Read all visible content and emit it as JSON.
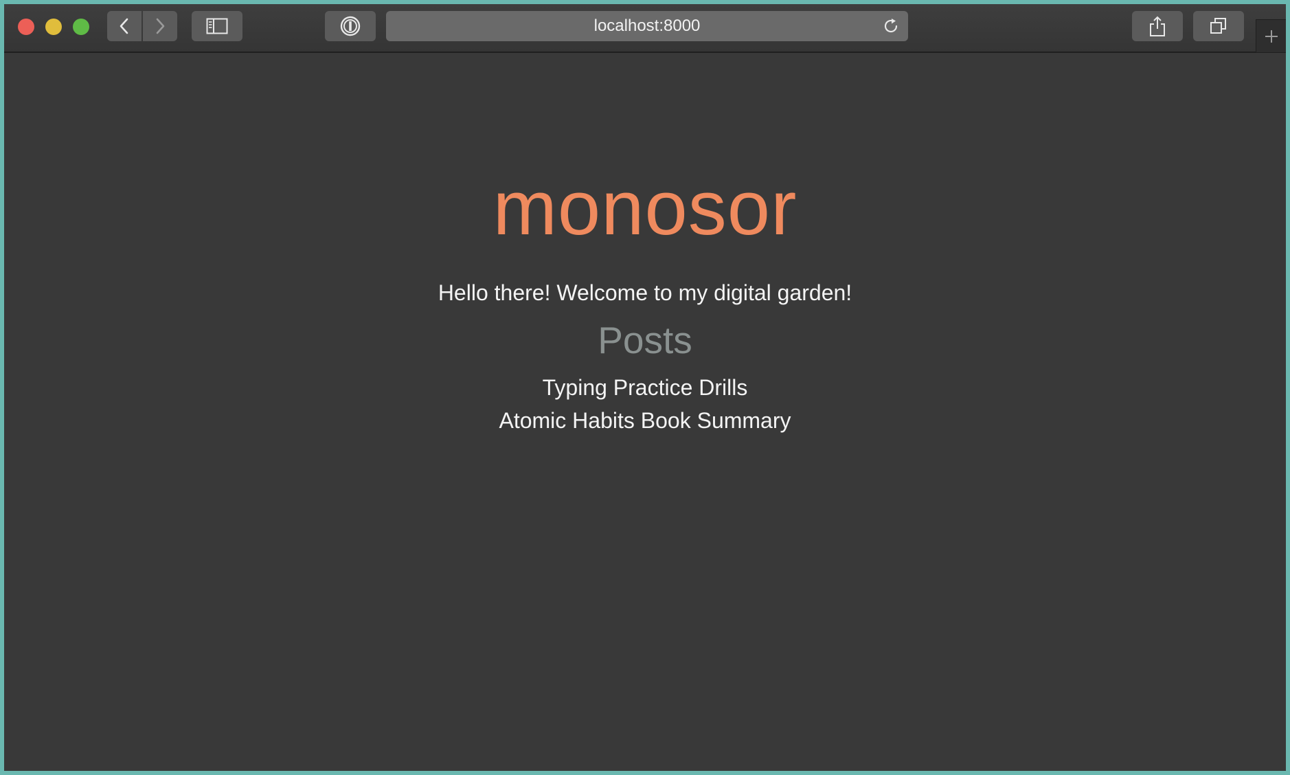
{
  "browser": {
    "url": "localhost:8000",
    "icons": {
      "back": "chevron-left-icon",
      "forward": "chevron-right-icon",
      "sidebar": "sidebar-icon",
      "password": "password-manager-icon",
      "reload": "reload-icon",
      "share": "share-icon",
      "tabs": "tab-overview-icon",
      "new_tab": "plus-icon"
    }
  },
  "page": {
    "title": "monosor",
    "welcome": "Hello there! Welcome to my digital garden!",
    "posts_heading": "Posts",
    "posts": [
      "Typing Practice Drills",
      "Atomic Habits Book Summary"
    ]
  },
  "colors": {
    "title": "#ef8a5e",
    "background": "#393939",
    "heading": "#8a9190",
    "text": "#f4f4f4"
  }
}
